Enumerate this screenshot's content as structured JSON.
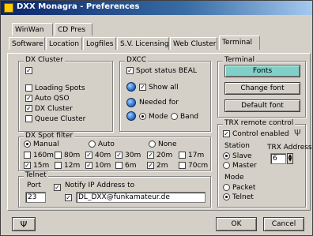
{
  "window": {
    "title": "DXX Monagra - Preferences"
  },
  "tabs": {
    "row1": [
      "WinWan",
      "CD Pres"
    ],
    "row2": [
      "Software",
      "Location",
      "Logfiles",
      "S.V. Licensing",
      "Web Cluster",
      "Terminal"
    ]
  },
  "dx_cluster": {
    "title": "DX Cluster",
    "items": [
      {
        "label": "Loading Spots",
        "checked": false
      },
      {
        "label": "Auto QSO",
        "checked": true
      },
      {
        "label": "DX Cluster",
        "checked": true
      },
      {
        "label": "Queue Cluster",
        "checked": false
      }
    ]
  },
  "dxcc": {
    "title": "DXCC",
    "sync_label": "Spot status BEAL",
    "show_all": "Show all",
    "needed_for": "Needed for",
    "mode": "Mode",
    "band": "Band"
  },
  "terminal": {
    "title": "Terminal",
    "fonts_button": "Fonts",
    "change_font": "Change font",
    "default_font": "Default font"
  },
  "dx_spot_filter": {
    "title": "DX Spot filter",
    "modes": [
      "Manual",
      "Auto",
      "None"
    ],
    "bands_row1": [
      "160m",
      "80m",
      "40m",
      "30m",
      "20m",
      "17m"
    ],
    "bands_row2": [
      "15m",
      "12m",
      "10m",
      "6m",
      "2m",
      "70cm"
    ]
  },
  "telnet": {
    "title": "Telnet",
    "port_label": "Port",
    "port_value": "23",
    "notify_label": "Notify IP Address to",
    "ip_value": "DL_DXX@funkamateur.de"
  },
  "trx_remote": {
    "title": "TRX remote control",
    "control_enabled": "Control enabled",
    "station_label": "Station",
    "slave": "Slave",
    "master": "Master",
    "trx_address_label": "TRX Address",
    "trx_address_value": "6",
    "mode_label": "Mode",
    "packet": "Packet",
    "telnet": "Telnet"
  },
  "footer": {
    "ok": "OK",
    "cancel": "Cancel"
  }
}
